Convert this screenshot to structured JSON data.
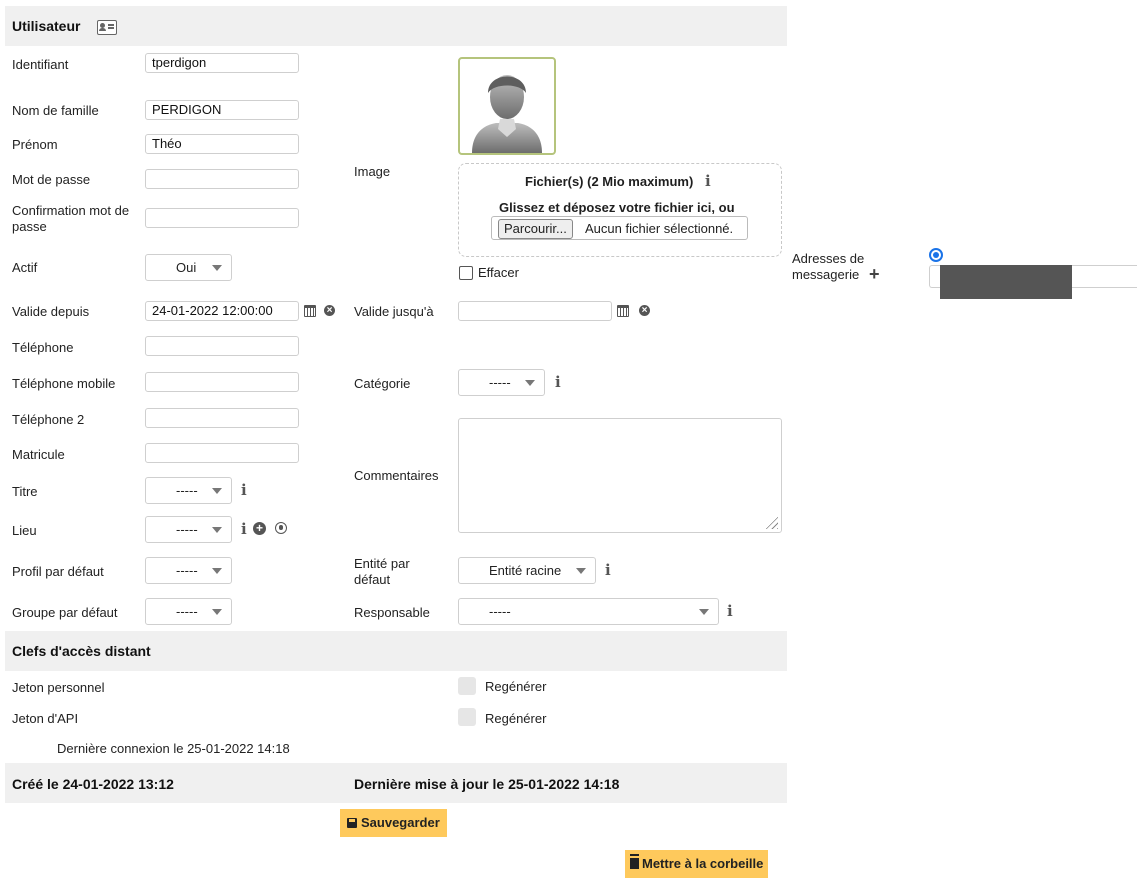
{
  "sections": {
    "user": "Utilisateur",
    "remote_keys": "Clefs d'accès distant"
  },
  "labels": {
    "identifiant": "Identifiant",
    "nom": "Nom de famille",
    "prenom": "Prénom",
    "mot_de_passe": "Mot de passe",
    "confirmation": "Confirmation mot de passe",
    "actif": "Actif",
    "valide_depuis": "Valide depuis",
    "valide_jusqua": "Valide jusqu'à",
    "telephone": "Téléphone",
    "telephone_mobile": "Téléphone mobile",
    "telephone2": "Téléphone 2",
    "matricule": "Matricule",
    "titre": "Titre",
    "lieu": "Lieu",
    "profil": "Profil par défaut",
    "groupe": "Groupe par défaut",
    "image": "Image",
    "categorie": "Catégorie",
    "commentaires": "Commentaires",
    "entite": "Entité par défaut",
    "responsable": "Responsable",
    "emails": "Adresses de messagerie",
    "jeton_perso": "Jeton personnel",
    "jeton_api": "Jeton d'API"
  },
  "values": {
    "identifiant": "tperdigon",
    "nom": "PERDIGON",
    "prenom": "Théo",
    "mot_de_passe": "",
    "confirmation": "",
    "actif": "Oui",
    "valide_depuis": "24-01-2022 12:00:00",
    "valide_jusqua": "",
    "telephone": "",
    "telephone_mobile": "",
    "telephone2": "",
    "matricule": "",
    "titre": "-----",
    "lieu": "-----",
    "profil": "-----",
    "groupe": "-----",
    "categorie": "-----",
    "entite": "Entité racine",
    "responsable": "-----",
    "commentaires": ""
  },
  "upload": {
    "max": "Fichier(s) (2 Mio maximum)",
    "drop": "Glissez et déposez votre fichier ici, ou",
    "browse": "Parcourir...",
    "no_file": "Aucun fichier sélectionné.",
    "clear": "Effacer"
  },
  "regenerate": "Regénérer",
  "last_login": "Dernière connexion le 25-01-2022 14:18",
  "created": "Créé le 24-01-2022 13:12",
  "updated": "Dernière mise à jour le 25-01-2022 14:18",
  "buttons": {
    "save": "Sauvegarder",
    "trash": "Mettre à la corbeille"
  },
  "colors": {
    "header_bg": "#f0f0f0",
    "action_button": "#fec95c",
    "avatar_border": "#b5c47c",
    "radio_blue": "#1a73e8",
    "redacted": "#555555"
  },
  "icons": {
    "user_card": "contact-card-icon",
    "calendar": "calendar-icon",
    "clear": "times-circle-icon",
    "info": "info-icon",
    "add": "plus-circle-icon",
    "globe": "globe-icon",
    "save": "floppy-disk-icon",
    "trash": "trash-icon"
  }
}
